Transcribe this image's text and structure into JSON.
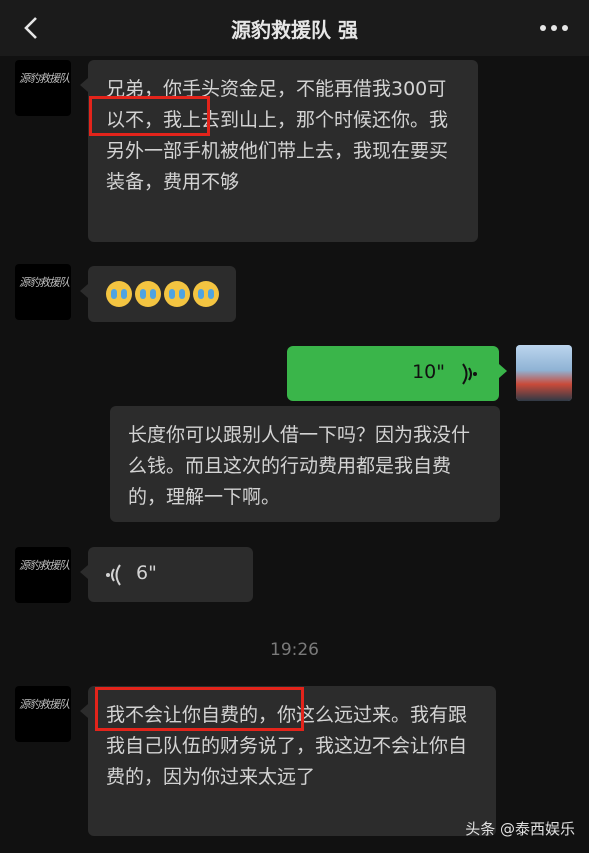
{
  "header": {
    "title": "源豹救援队 强"
  },
  "avatar_text": "源豹救援队",
  "messages": {
    "m1": "兄弟，你手头资金足，不能再借我300可以不，我上去到山上，那个时候还你。我另外一部手机被他们带上去，我现在要买装备，费用不够",
    "m3_voice": "10\"",
    "m4": "长度你可以跟别人借一下吗？因为我没什么钱。而且这次的行动费用都是我自费的，理解一下啊。",
    "m5_voice": "6\"",
    "timestamp": "19:26",
    "m6": "我不会让你自费的，你这么远过来。我有跟我自己队伍的财务说了，我这边不会让你自费的，因为你过来太远了"
  },
  "watermark": "头条 @泰西娱乐",
  "colors": {
    "bg": "#111111",
    "bubble": "#2c2c2c",
    "green": "#3ab54a",
    "highlight": "#e3241b"
  }
}
